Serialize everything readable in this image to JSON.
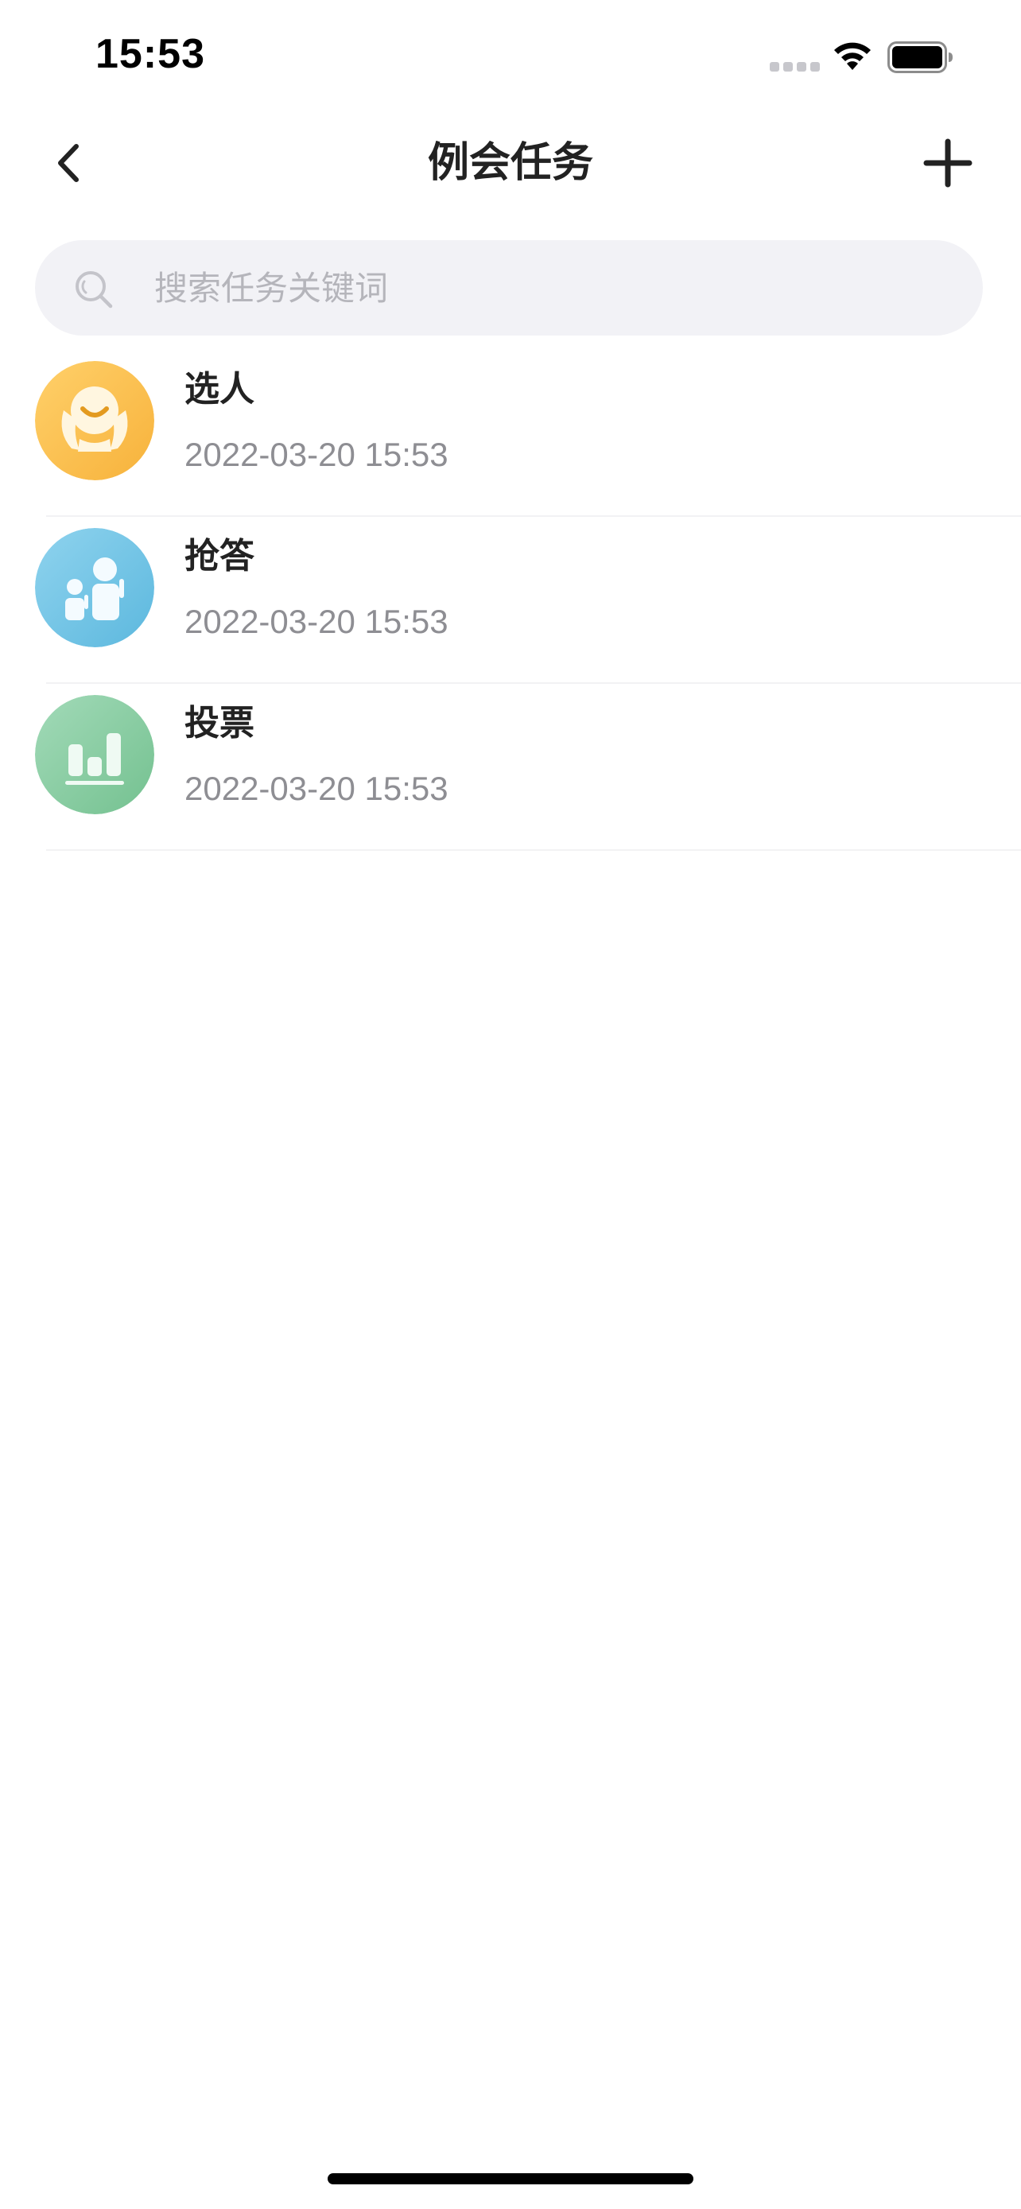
{
  "status_bar": {
    "time": "15:53",
    "icons": [
      "signal-dots-icon",
      "wifi-icon",
      "battery-icon"
    ]
  },
  "nav": {
    "title": "例会任务",
    "back_icon": "chevron-left-icon",
    "add_icon": "plus-icon"
  },
  "search": {
    "placeholder": "搜索任务关键词",
    "value": "",
    "icon": "search-icon"
  },
  "tasks": [
    {
      "name": "选人",
      "time": "2022-03-20 15:53",
      "icon": "select-person-icon",
      "color": "#fcc04a"
    },
    {
      "name": "抢答",
      "time": "2022-03-20 15:53",
      "icon": "quick-answer-icon",
      "color": "#6ec4e4"
    },
    {
      "name": "投票",
      "time": "2022-03-20 15:53",
      "icon": "vote-chart-icon",
      "color": "#86cca4"
    }
  ],
  "colors": {
    "title_text": "#222222",
    "secondary_text": "#8e8e93",
    "search_bg": "#f2f2f6",
    "placeholder_text": "#b5b5bb"
  }
}
